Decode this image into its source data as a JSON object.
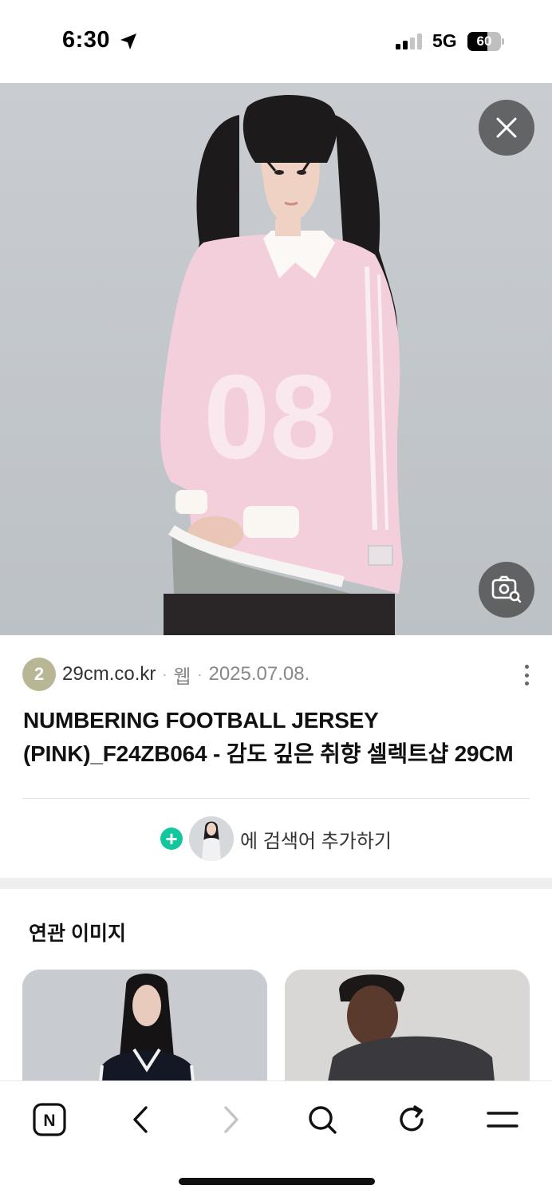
{
  "status_bar": {
    "time": "6:30",
    "network": "5G",
    "battery_level": "60",
    "battery_fraction": 0.6,
    "icons": [
      "location-arrow-icon",
      "signal-icon",
      "battery-icon"
    ]
  },
  "hero": {
    "close_icon": "close-icon",
    "lens_icon": "image-search-icon"
  },
  "result": {
    "source_rank": "2",
    "domain": "29cm.co.kr",
    "separator": "·",
    "type": "웹",
    "date": "2025.07.08.",
    "title": "NUMBERING FOOTBALL JERSEY (PINK)_F24ZB064 - 감도 깊은 취향 셀렉트샵 29CM"
  },
  "add_search": {
    "label": "에 검색어 추가하기",
    "plus": "+"
  },
  "related": {
    "title": "연관 이미지"
  },
  "toolbar": {
    "home_label": "N",
    "icons": [
      "naver-home-icon",
      "back-icon",
      "forward-icon",
      "search-icon",
      "refresh-icon",
      "menu-icon"
    ]
  },
  "colors": {
    "accent_green": "#12c79e",
    "badge": "#b9b695",
    "overlay": "#464646"
  }
}
